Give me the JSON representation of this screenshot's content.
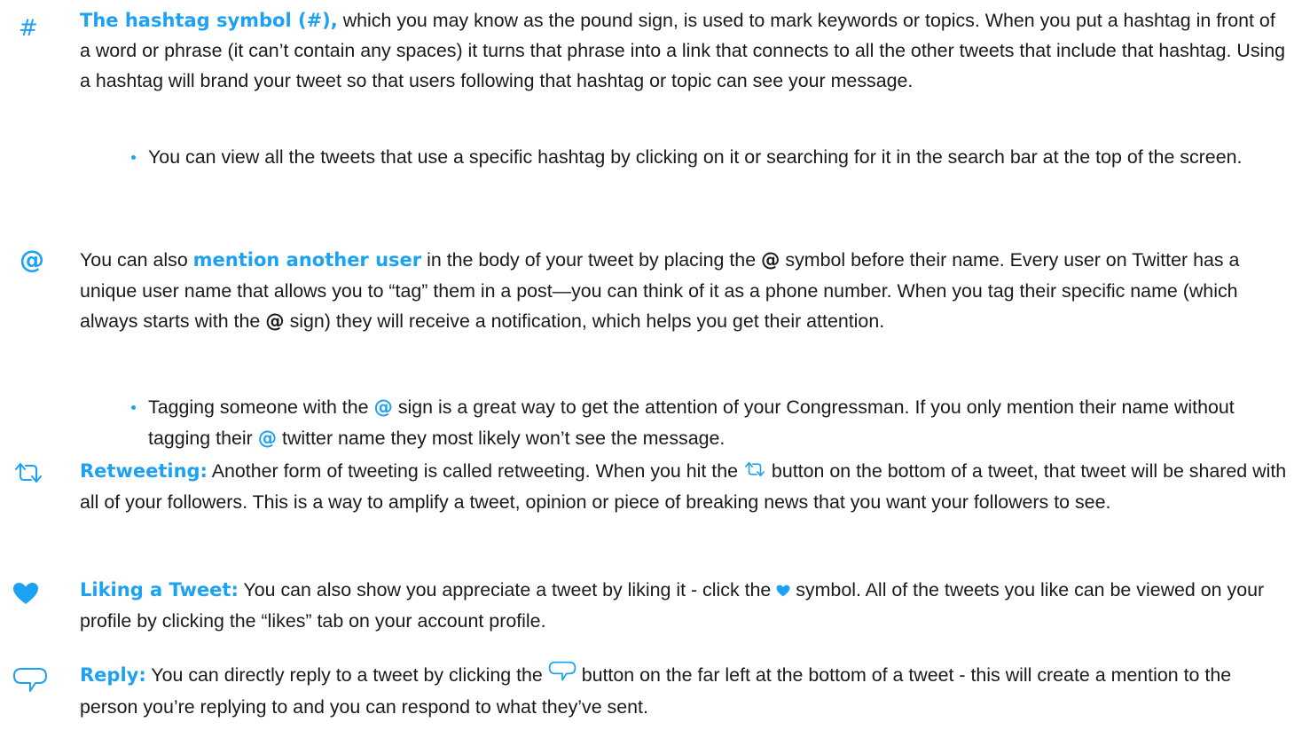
{
  "colors": {
    "accent": "#1da1f2",
    "text": "#1a1a1a"
  },
  "icons": {
    "hashtag": "hashtag-icon",
    "mention": "at-sign-icon",
    "retweet": "retweet-icon",
    "like": "heart-icon",
    "reply": "reply-bubble-icon"
  },
  "hashtag": {
    "icon_glyph": "#",
    "lead": "The hashtag symbol (#),",
    "body": " which you may know as the pound sign, is used to mark keywords or topics. When you put a hashtag in front of a word or phrase (it can’t contain any spaces) it turns that phrase into a link that connects to all the other tweets that include that hashtag. Using a hashtag will brand your tweet so that users following that hashtag or topic can see your message.",
    "bullet": "You can view all the tweets that use a specific hashtag by clicking on it or searching for it in the search bar at the top of the screen."
  },
  "mention": {
    "icon_glyph": "@",
    "pre": "You can also ",
    "lead": "mention another user",
    "mid1": " in the body of your tweet by placing the ",
    "at1": "@",
    "mid2": " symbol before their name. Every user on Twitter has a unique user name that allows you to “tag” them in a post—you can think of it as a phone number. When you tag their specific name (which always starts with the ",
    "at2": "@",
    "mid3": " sign) they will receive a notification, which helps you get their attention.",
    "bullet_pre": "Tagging someone with the ",
    "bullet_at1": "@",
    "bullet_mid": " sign is a great way to get the attention of your Congressman. If you only mention their name without tagging their ",
    "bullet_at2": "@",
    "bullet_post": " twitter name they most likely won’t see the message."
  },
  "retweet": {
    "lead": "Retweeting:",
    "pre": " Another form of tweeting is called retweeting. When you hit the ",
    "post": " button on the bottom of a tweet, that tweet will be shared with all of your followers. This is a way to amplify a tweet, opinion or piece of breaking news that you want your followers to see."
  },
  "like": {
    "lead": "Liking a Tweet:",
    "pre": " You can also show you appreciate a tweet by liking it - click the ",
    "post": " symbol. All of the tweets you like can be viewed on your profile by clicking the “likes” tab on your account profile."
  },
  "reply": {
    "lead": "Reply:",
    "pre": " You can directly reply to a tweet by clicking the ",
    "post": " button on the far left at the bottom of a tweet - this will create a mention to the person you’re replying to and you can respond to what they’ve sent."
  }
}
